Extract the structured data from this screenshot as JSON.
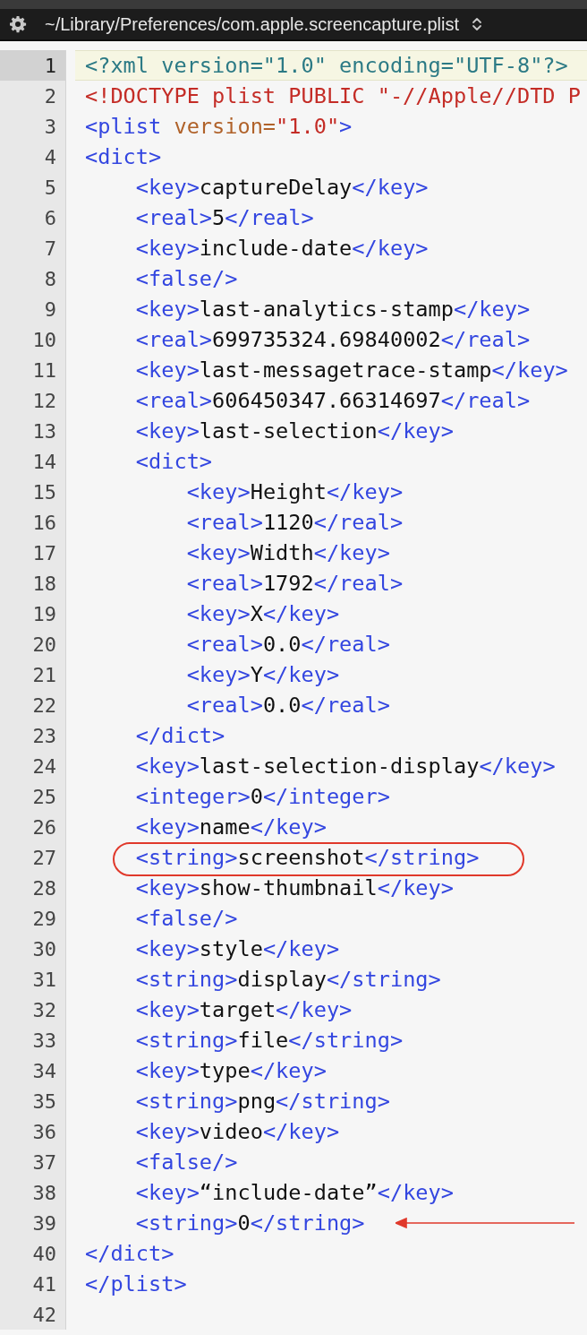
{
  "title_bar": {
    "path": "~/Library/Preferences/com.apple.screencapture.plist"
  },
  "lines": [
    {
      "number": "1",
      "selected": true,
      "circled": false,
      "arrowed": false,
      "tokens": [
        {
          "kind": "decl",
          "text": "<?xml version=\"1.0\" encoding=\"UTF-8\"?>"
        }
      ]
    },
    {
      "number": "2",
      "selected": false,
      "circled": false,
      "arrowed": false,
      "tokens": [
        {
          "kind": "doctype",
          "text": "<!DOCTYPE plist PUBLIC \"-//Apple//DTD P"
        }
      ]
    },
    {
      "number": "3",
      "selected": false,
      "circled": false,
      "arrowed": false,
      "tokens": [
        {
          "kind": "tag",
          "text": "<plist "
        },
        {
          "kind": "attr",
          "text": "version="
        },
        {
          "kind": "string",
          "text": "\"1.0\""
        },
        {
          "kind": "tag",
          "text": ">"
        }
      ]
    },
    {
      "number": "4",
      "selected": false,
      "circled": false,
      "arrowed": false,
      "tokens": [
        {
          "kind": "tag",
          "text": "<dict>"
        }
      ]
    },
    {
      "number": "5",
      "selected": false,
      "circled": false,
      "arrowed": false,
      "tokens": [
        {
          "kind": "tag",
          "text": "    <key>"
        },
        {
          "kind": "text",
          "text": "captureDelay"
        },
        {
          "kind": "tag",
          "text": "</key>"
        }
      ]
    },
    {
      "number": "6",
      "selected": false,
      "circled": false,
      "arrowed": false,
      "tokens": [
        {
          "kind": "tag",
          "text": "    <real>"
        },
        {
          "kind": "text",
          "text": "5"
        },
        {
          "kind": "tag",
          "text": "</real>"
        }
      ]
    },
    {
      "number": "7",
      "selected": false,
      "circled": false,
      "arrowed": false,
      "tokens": [
        {
          "kind": "tag",
          "text": "    <key>"
        },
        {
          "kind": "text",
          "text": "include-date"
        },
        {
          "kind": "tag",
          "text": "</key>"
        }
      ]
    },
    {
      "number": "8",
      "selected": false,
      "circled": false,
      "arrowed": false,
      "tokens": [
        {
          "kind": "tag",
          "text": "    <false/>"
        }
      ]
    },
    {
      "number": "9",
      "selected": false,
      "circled": false,
      "arrowed": false,
      "tokens": [
        {
          "kind": "tag",
          "text": "    <key>"
        },
        {
          "kind": "text",
          "text": "last-analytics-stamp"
        },
        {
          "kind": "tag",
          "text": "</key>"
        }
      ]
    },
    {
      "number": "10",
      "selected": false,
      "circled": false,
      "arrowed": false,
      "tokens": [
        {
          "kind": "tag",
          "text": "    <real>"
        },
        {
          "kind": "text",
          "text": "699735324.69840002"
        },
        {
          "kind": "tag",
          "text": "</real>"
        }
      ]
    },
    {
      "number": "11",
      "selected": false,
      "circled": false,
      "arrowed": false,
      "tokens": [
        {
          "kind": "tag",
          "text": "    <key>"
        },
        {
          "kind": "text",
          "text": "last-messagetrace-stamp"
        },
        {
          "kind": "tag",
          "text": "</key>"
        }
      ]
    },
    {
      "number": "12",
      "selected": false,
      "circled": false,
      "arrowed": false,
      "tokens": [
        {
          "kind": "tag",
          "text": "    <real>"
        },
        {
          "kind": "text",
          "text": "606450347.66314697"
        },
        {
          "kind": "tag",
          "text": "</real>"
        }
      ]
    },
    {
      "number": "13",
      "selected": false,
      "circled": false,
      "arrowed": false,
      "tokens": [
        {
          "kind": "tag",
          "text": "    <key>"
        },
        {
          "kind": "text",
          "text": "last-selection"
        },
        {
          "kind": "tag",
          "text": "</key>"
        }
      ]
    },
    {
      "number": "14",
      "selected": false,
      "circled": false,
      "arrowed": false,
      "tokens": [
        {
          "kind": "tag",
          "text": "    <dict>"
        }
      ]
    },
    {
      "number": "15",
      "selected": false,
      "circled": false,
      "arrowed": false,
      "tokens": [
        {
          "kind": "tag",
          "text": "        <key>"
        },
        {
          "kind": "text",
          "text": "Height"
        },
        {
          "kind": "tag",
          "text": "</key>"
        }
      ]
    },
    {
      "number": "16",
      "selected": false,
      "circled": false,
      "arrowed": false,
      "tokens": [
        {
          "kind": "tag",
          "text": "        <real>"
        },
        {
          "kind": "text",
          "text": "1120"
        },
        {
          "kind": "tag",
          "text": "</real>"
        }
      ]
    },
    {
      "number": "17",
      "selected": false,
      "circled": false,
      "arrowed": false,
      "tokens": [
        {
          "kind": "tag",
          "text": "        <key>"
        },
        {
          "kind": "text",
          "text": "Width"
        },
        {
          "kind": "tag",
          "text": "</key>"
        }
      ]
    },
    {
      "number": "18",
      "selected": false,
      "circled": false,
      "arrowed": false,
      "tokens": [
        {
          "kind": "tag",
          "text": "        <real>"
        },
        {
          "kind": "text",
          "text": "1792"
        },
        {
          "kind": "tag",
          "text": "</real>"
        }
      ]
    },
    {
      "number": "19",
      "selected": false,
      "circled": false,
      "arrowed": false,
      "tokens": [
        {
          "kind": "tag",
          "text": "        <key>"
        },
        {
          "kind": "text",
          "text": "X"
        },
        {
          "kind": "tag",
          "text": "</key>"
        }
      ]
    },
    {
      "number": "20",
      "selected": false,
      "circled": false,
      "arrowed": false,
      "tokens": [
        {
          "kind": "tag",
          "text": "        <real>"
        },
        {
          "kind": "text",
          "text": "0.0"
        },
        {
          "kind": "tag",
          "text": "</real>"
        }
      ]
    },
    {
      "number": "21",
      "selected": false,
      "circled": false,
      "arrowed": false,
      "tokens": [
        {
          "kind": "tag",
          "text": "        <key>"
        },
        {
          "kind": "text",
          "text": "Y"
        },
        {
          "kind": "tag",
          "text": "</key>"
        }
      ]
    },
    {
      "number": "22",
      "selected": false,
      "circled": false,
      "arrowed": false,
      "tokens": [
        {
          "kind": "tag",
          "text": "        <real>"
        },
        {
          "kind": "text",
          "text": "0.0"
        },
        {
          "kind": "tag",
          "text": "</real>"
        }
      ]
    },
    {
      "number": "23",
      "selected": false,
      "circled": false,
      "arrowed": false,
      "tokens": [
        {
          "kind": "tag",
          "text": "    </dict>"
        }
      ]
    },
    {
      "number": "24",
      "selected": false,
      "circled": false,
      "arrowed": false,
      "tokens": [
        {
          "kind": "tag",
          "text": "    <key>"
        },
        {
          "kind": "text",
          "text": "last-selection-display"
        },
        {
          "kind": "tag",
          "text": "</key>"
        }
      ]
    },
    {
      "number": "25",
      "selected": false,
      "circled": false,
      "arrowed": false,
      "tokens": [
        {
          "kind": "tag",
          "text": "    <integer>"
        },
        {
          "kind": "text",
          "text": "0"
        },
        {
          "kind": "tag",
          "text": "</integer>"
        }
      ]
    },
    {
      "number": "26",
      "selected": false,
      "circled": false,
      "arrowed": false,
      "tokens": [
        {
          "kind": "tag",
          "text": "    <key>"
        },
        {
          "kind": "text",
          "text": "name"
        },
        {
          "kind": "tag",
          "text": "</key>"
        }
      ]
    },
    {
      "number": "27",
      "selected": false,
      "circled": true,
      "arrowed": false,
      "tokens": [
        {
          "kind": "tag",
          "text": "    <string>"
        },
        {
          "kind": "text",
          "text": "screenshot"
        },
        {
          "kind": "tag",
          "text": "</string>"
        }
      ]
    },
    {
      "number": "28",
      "selected": false,
      "circled": false,
      "arrowed": false,
      "tokens": [
        {
          "kind": "tag",
          "text": "    <key>"
        },
        {
          "kind": "text",
          "text": "show-thumbnail"
        },
        {
          "kind": "tag",
          "text": "</key>"
        }
      ]
    },
    {
      "number": "29",
      "selected": false,
      "circled": false,
      "arrowed": false,
      "tokens": [
        {
          "kind": "tag",
          "text": "    <false/>"
        }
      ]
    },
    {
      "number": "30",
      "selected": false,
      "circled": false,
      "arrowed": false,
      "tokens": [
        {
          "kind": "tag",
          "text": "    <key>"
        },
        {
          "kind": "text",
          "text": "style"
        },
        {
          "kind": "tag",
          "text": "</key>"
        }
      ]
    },
    {
      "number": "31",
      "selected": false,
      "circled": false,
      "arrowed": false,
      "tokens": [
        {
          "kind": "tag",
          "text": "    <string>"
        },
        {
          "kind": "text",
          "text": "display"
        },
        {
          "kind": "tag",
          "text": "</string>"
        }
      ]
    },
    {
      "number": "32",
      "selected": false,
      "circled": false,
      "arrowed": false,
      "tokens": [
        {
          "kind": "tag",
          "text": "    <key>"
        },
        {
          "kind": "text",
          "text": "target"
        },
        {
          "kind": "tag",
          "text": "</key>"
        }
      ]
    },
    {
      "number": "33",
      "selected": false,
      "circled": false,
      "arrowed": false,
      "tokens": [
        {
          "kind": "tag",
          "text": "    <string>"
        },
        {
          "kind": "text",
          "text": "file"
        },
        {
          "kind": "tag",
          "text": "</string>"
        }
      ]
    },
    {
      "number": "34",
      "selected": false,
      "circled": false,
      "arrowed": false,
      "tokens": [
        {
          "kind": "tag",
          "text": "    <key>"
        },
        {
          "kind": "text",
          "text": "type"
        },
        {
          "kind": "tag",
          "text": "</key>"
        }
      ]
    },
    {
      "number": "35",
      "selected": false,
      "circled": false,
      "arrowed": false,
      "tokens": [
        {
          "kind": "tag",
          "text": "    <string>"
        },
        {
          "kind": "text",
          "text": "png"
        },
        {
          "kind": "tag",
          "text": "</string>"
        }
      ]
    },
    {
      "number": "36",
      "selected": false,
      "circled": false,
      "arrowed": false,
      "tokens": [
        {
          "kind": "tag",
          "text": "    <key>"
        },
        {
          "kind": "text",
          "text": "video"
        },
        {
          "kind": "tag",
          "text": "</key>"
        }
      ]
    },
    {
      "number": "37",
      "selected": false,
      "circled": false,
      "arrowed": false,
      "tokens": [
        {
          "kind": "tag",
          "text": "    <false/>"
        }
      ]
    },
    {
      "number": "38",
      "selected": false,
      "circled": false,
      "arrowed": false,
      "tokens": [
        {
          "kind": "tag",
          "text": "    <key>"
        },
        {
          "kind": "text",
          "text": "“include-date”"
        },
        {
          "kind": "tag",
          "text": "</key>"
        }
      ]
    },
    {
      "number": "39",
      "selected": false,
      "circled": false,
      "arrowed": true,
      "tokens": [
        {
          "kind": "tag",
          "text": "    <string>"
        },
        {
          "kind": "text",
          "text": "0"
        },
        {
          "kind": "tag",
          "text": "</string>"
        }
      ]
    },
    {
      "number": "40",
      "selected": false,
      "circled": false,
      "arrowed": false,
      "tokens": [
        {
          "kind": "tag",
          "text": "</dict>"
        }
      ]
    },
    {
      "number": "41",
      "selected": false,
      "circled": false,
      "arrowed": false,
      "tokens": [
        {
          "kind": "tag",
          "text": "</plist>"
        }
      ]
    },
    {
      "number": "42",
      "selected": false,
      "circled": false,
      "arrowed": false
    }
  ]
}
